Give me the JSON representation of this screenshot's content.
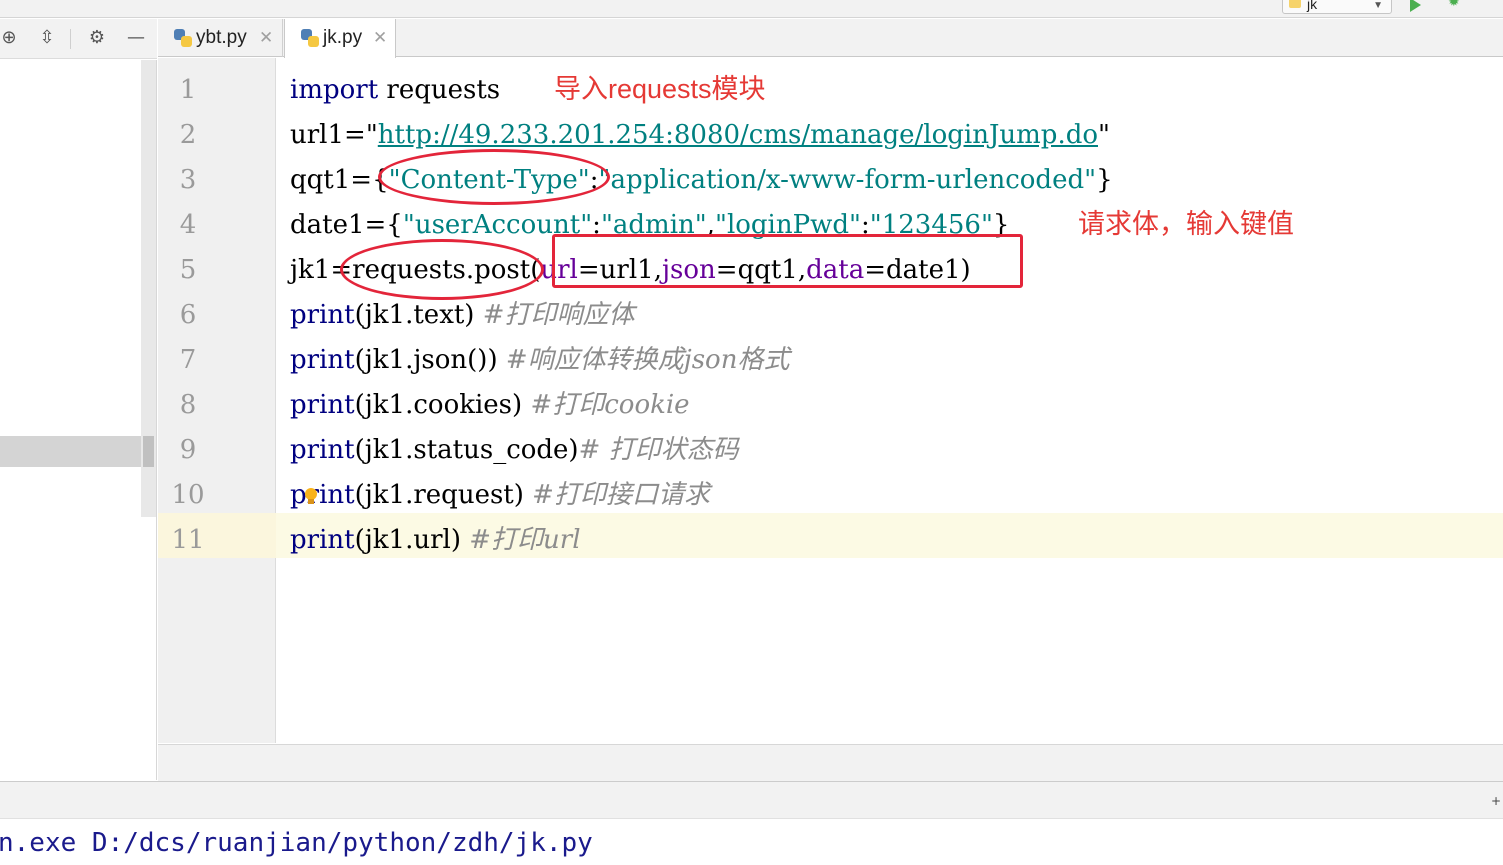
{
  "toolbar": {
    "run_config_label": "jk",
    "run_icon": "run-icon",
    "debug_icon": "debug-icon"
  },
  "project_toolbar": {
    "icons": [
      "locate-icon",
      "collapse-icon",
      "gear-icon",
      "hide-icon"
    ]
  },
  "tabs": [
    {
      "label": "ybt.py",
      "icon": "python-file-icon",
      "active": false
    },
    {
      "label": "jk.py",
      "icon": "python-file-icon",
      "active": true
    }
  ],
  "editor": {
    "line_numbers": [
      "1",
      "2",
      "3",
      "4",
      "5",
      "6",
      "7",
      "8",
      "9",
      "10",
      "11"
    ],
    "current_line": "11",
    "lines": {
      "l1": {
        "kw": "import",
        "rest": " requests"
      },
      "l2": {
        "pre": "url1=\"",
        "url": "http://49.233.201.254:8080/cms/manage/loginJump.do",
        "post": "\""
      },
      "l3": {
        "pre": "qqt1={",
        "key": "\"Content-Type\"",
        "sep": ":",
        "val": "\"application/x-www-form-urlencoded\"",
        "post": "}"
      },
      "l4": {
        "pre": "date1={",
        "k1": "\"userAccount\"",
        "s1": ":",
        "v1": "\"admin\"",
        "c1": ",",
        "k2": "\"loginPwd\"",
        "s2": ":",
        "v2": "\"123456\"",
        "post": "}"
      },
      "l5": {
        "pre": "jk1=requests.post(",
        "p1": "url",
        "a1": "=url1,",
        "p2": "json",
        "a2": "=qqt1,",
        "p3": "data",
        "a3": "=date1)"
      },
      "l6": {
        "fn": "print",
        "args": "(jk1.text)",
        "cmt": "#打印响应体"
      },
      "l7": {
        "fn": "print",
        "args": "(jk1.json())",
        "cmt": "#响应体转换成json格式"
      },
      "l8": {
        "fn": "print",
        "args": "(jk1.cookies)",
        "cmt": "#打印cookie"
      },
      "l9": {
        "fn": "print",
        "args": "(jk1.status_code)",
        "cmt": "# 打印状态码"
      },
      "l10": {
        "fn": "print",
        "args": "(jk1.request)",
        "cmt": "#打印接口请求"
      },
      "l11": {
        "fn": "print",
        "args": "(jk1.url)",
        "cmt": "#打印url"
      }
    },
    "annotations": {
      "note1": "导入requests模块",
      "note2": "请求体，输入键值"
    },
    "intention_icon": "lightbulb-icon"
  },
  "console": {
    "line": "n.exe D:/dcs/ruanjian/python/zdh/jk.py"
  }
}
